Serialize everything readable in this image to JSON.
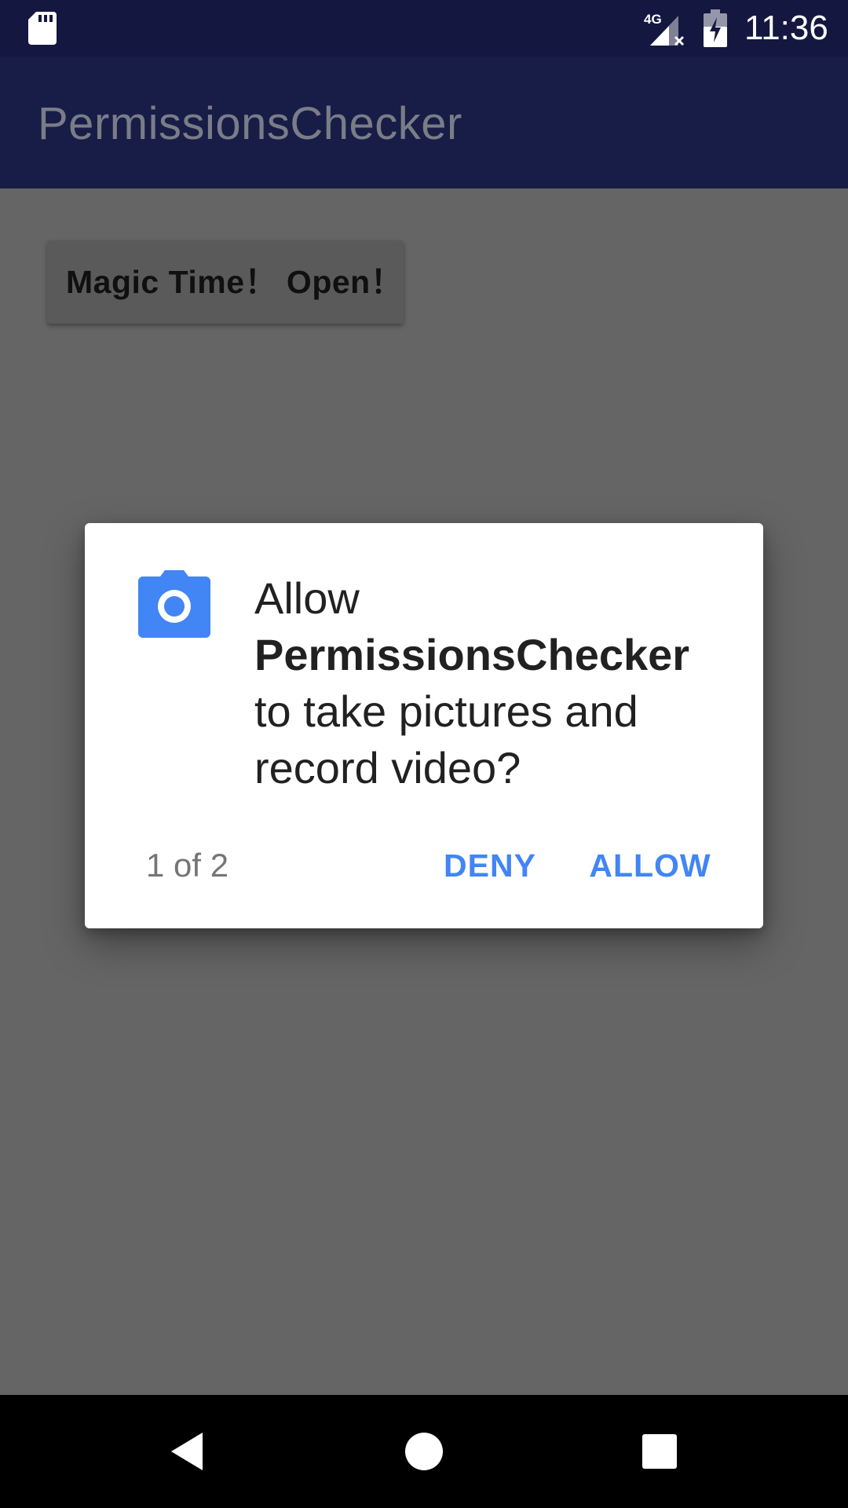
{
  "status_bar": {
    "time": "11:36",
    "network_label": "4G",
    "icons": [
      "sd-card-icon",
      "signal-no-data-icon",
      "battery-charging-icon"
    ]
  },
  "app_bar": {
    "title": "PermissionsChecker"
  },
  "main": {
    "magic_button_label": "Magic Time！ Open！"
  },
  "dialog": {
    "icon": "camera-icon",
    "message_prefix": "Allow",
    "app_name": "PermissionsChecker",
    "message_line_1": "to take pictures and",
    "message_line_2": "record video?",
    "page_counter": "1 of 2",
    "deny_label": "DENY",
    "allow_label": "ALLOW",
    "accent_color": "#4285f4"
  },
  "nav_bar": {
    "icons": [
      "back-icon",
      "home-icon",
      "recents-icon"
    ]
  }
}
